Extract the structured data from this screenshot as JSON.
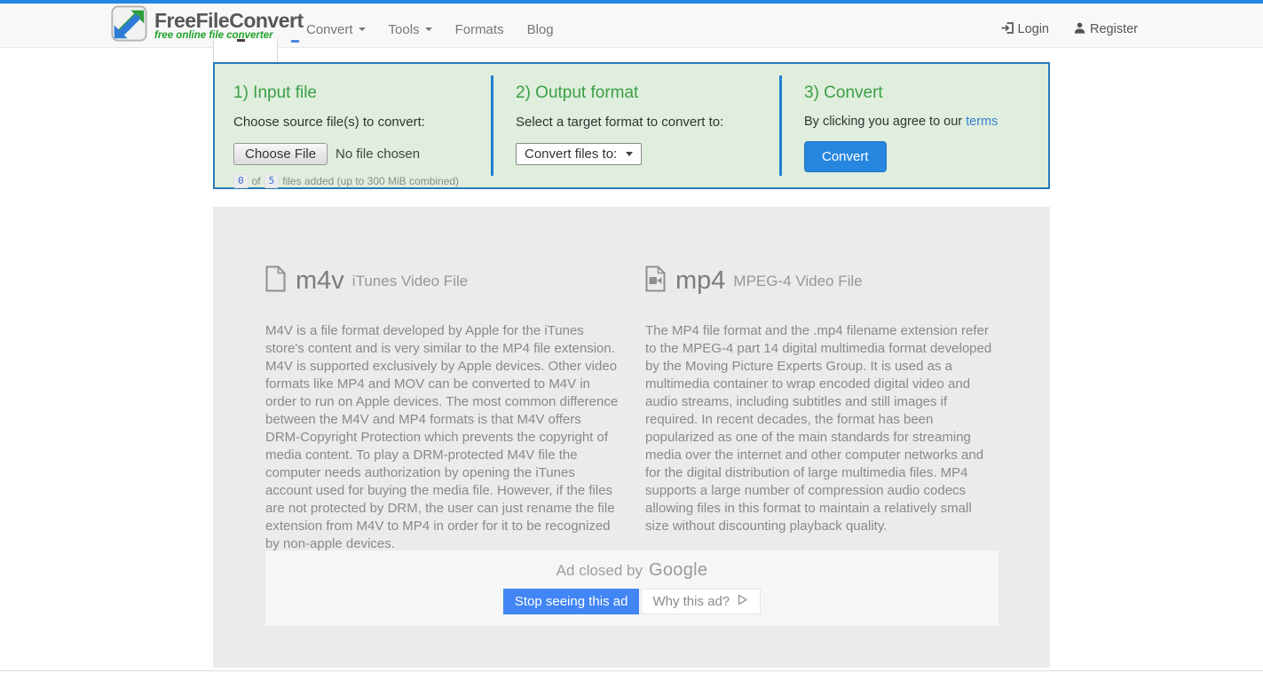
{
  "colors": {
    "top_strip_blue": "#2386e2",
    "navbar_bg": "#f8f8f8",
    "green_heading": "#3ba045",
    "panel_bg": "#dfeedd",
    "panel_border_blue": "#2779bd",
    "convert_button_blue": "#2787e0",
    "google_ad_blue": "#4285f4",
    "content_bg": "#ebebeb",
    "link_blue": "#3a7fd0",
    "tagline_green": "#1fa32a"
  },
  "nav": {
    "brand_title": "FreeFileConvert",
    "brand_tagline": "free online file converter",
    "items": [
      {
        "label": "Convert"
      },
      {
        "label": "Tools"
      },
      {
        "label": "Formats"
      },
      {
        "label": "Blog"
      }
    ],
    "login_label": "Login",
    "register_label": "Register"
  },
  "converter": {
    "step1": {
      "title": "1) Input file",
      "instruction": "Choose source file(s) to convert:",
      "choose_file_button": "Choose File",
      "file_status": "No file chosen",
      "counter_current": "0",
      "counter_of": "of",
      "counter_max": "5",
      "counter_suffix": "files added (up to 300 MiB combined)"
    },
    "step2": {
      "title": "2) Output format",
      "instruction": "Select a target format to convert to:",
      "select_label": "Convert files to:"
    },
    "step3": {
      "title": "3) Convert",
      "agree_prefix": "By clicking you agree to our",
      "terms_link": "terms",
      "convert_button": "Convert"
    }
  },
  "formats": {
    "left": {
      "extension": "m4v",
      "name": "iTunes Video File",
      "description": "M4V is a file format developed by Apple for the iTunes store's content and is very similar to the MP4 file extension. M4V is supported exclusively by Apple devices. Other video formats like MP4 and MOV can be converted to M4V in order to run on Apple devices. The most common difference between the M4V and MP4 formats is that M4V offers DRM-Copyright Protection which prevents the copyright of media content. To play a DRM-protected M4V file the computer needs authorization by opening the iTunes account used for buying the media file. However, if the files are not protected by DRM, the user can just rename the file extension from M4V to MP4 in order for it to be recognized by non-apple devices."
    },
    "right": {
      "extension": "mp4",
      "name": "MPEG-4 Video File",
      "description": "The MP4 file format and the .mp4 filename extension refer to the MPEG-4 part 14 digital multimedia format developed by the Moving Picture Experts Group. It is used as a multimedia container to wrap encoded digital video and audio streams, including subtitles and still images if required. In recent decades, the format has been popularized as one of the main standards for streaming media over the internet and other computer networks and for the digital distribution of large multimedia files. MP4 supports a large number of compression audio codecs allowing files in this format to maintain a relatively small size without discounting playback quality."
    }
  },
  "ad": {
    "closed_prefix": "Ad closed by",
    "google_brand": "Google",
    "stop_button": "Stop seeing this ad",
    "why_button": "Why this ad?"
  }
}
